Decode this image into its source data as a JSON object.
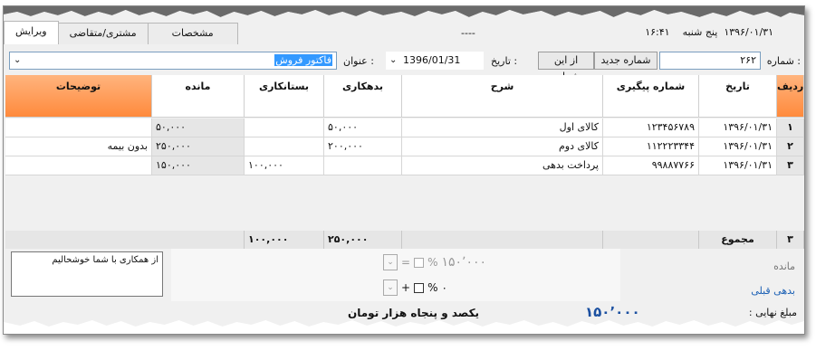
{
  "header": {
    "time": "۱۶:۴۱",
    "day": "پنج شنبه",
    "date": "۱۳۹۶/۰۱/۳۱",
    "dash": "----"
  },
  "tabs": [
    {
      "label": "ویرایش"
    },
    {
      "label": "مشتری/متقاضی"
    },
    {
      "label": "مشخصات"
    }
  ],
  "form": {
    "number_label": "شماره :",
    "number_value": "۲۶۲",
    "new_number_button": "شماره جدید",
    "from_number_button": "از این شماره",
    "date_label": "تاریخ :",
    "date_value": "1396/01/31",
    "title_label": "عنوان :",
    "title_value": "فاکتور فروش"
  },
  "table": {
    "columns": [
      "ردیف",
      "تاریخ",
      "شماره پیگیری",
      "شرح",
      "بدهکاری",
      "بستانکاری",
      "مانده",
      "توضیحات"
    ],
    "rows": [
      {
        "rn": "۱",
        "date": "۱۳۹۶/۰۱/۳۱",
        "tracking": "۱۲۳۴۵۶۷۸۹",
        "desc": "کالای اول",
        "debit": "۵۰,۰۰۰",
        "credit": "",
        "balance": "۵۰,۰۰۰",
        "notes": ""
      },
      {
        "rn": "۲",
        "date": "۱۳۹۶/۰۱/۳۱",
        "tracking": "۱۱۲۲۲۳۳۴۴",
        "desc": "کالای دوم",
        "debit": "۲۰۰,۰۰۰",
        "credit": "",
        "balance": "۲۵۰,۰۰۰",
        "notes": "بدون بیمه"
      },
      {
        "rn": "۳",
        "date": "۱۳۹۶/۰۱/۳۱",
        "tracking": "۹۹۸۸۷۷۶۶",
        "desc": "پرداخت بدهی",
        "debit": "",
        "credit": "۱۰۰,۰۰۰",
        "balance": "۱۵۰,۰۰۰",
        "notes": ""
      }
    ]
  },
  "summary": {
    "count": "۳",
    "label": "مجموع",
    "debit_total": "۲۵۰,۰۰۰",
    "credit_total": "۱۰۰,۰۰۰"
  },
  "notes_text": "از همکاری با شما خوشحالیم",
  "balance_label": "مانده",
  "previous_debt_label": "بدهی قبلی",
  "discount": {
    "value_top": "۱۵۰٬۰۰۰",
    "percent_label": "%",
    "value_bottom": "۰",
    "plus": "+",
    "eq": "="
  },
  "final": {
    "label": "مبلغ نهایی :",
    "amount": "۱۵۰٬۰۰۰",
    "words": "یکصد و پنجاه  هزار  تومان"
  },
  "colors": {
    "accent_orange": "#ff8a3c",
    "selection_blue": "#3399ff",
    "amount_blue": "#1a4fa0"
  }
}
